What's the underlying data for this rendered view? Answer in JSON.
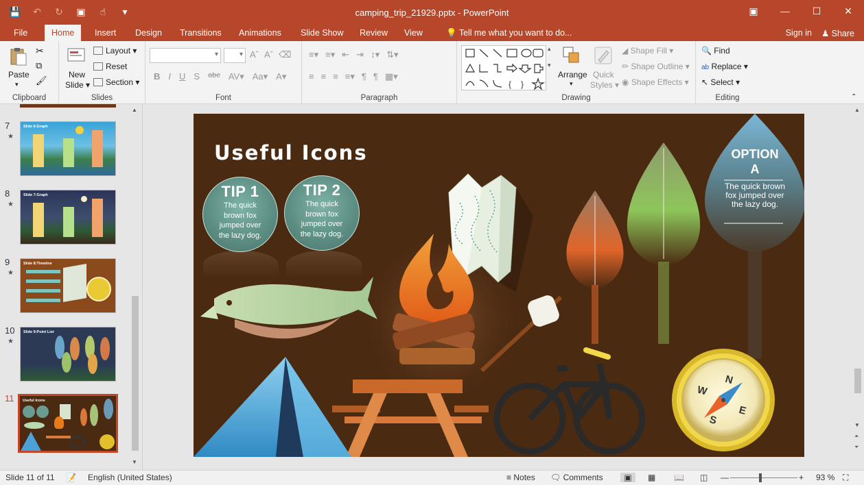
{
  "app": {
    "doc_title": "camping_trip_21929.pptx - PowerPoint",
    "accent": "#b7472a"
  },
  "tabs": [
    {
      "label": "File"
    },
    {
      "label": "Home"
    },
    {
      "label": "Insert"
    },
    {
      "label": "Design"
    },
    {
      "label": "Transitions"
    },
    {
      "label": "Animations"
    },
    {
      "label": "Slide Show"
    },
    {
      "label": "Review"
    },
    {
      "label": "View"
    }
  ],
  "tell_me": "Tell me what you want to do...",
  "sign_in": "Sign in",
  "share": "Share",
  "ribbon": {
    "clipboard": {
      "paste": "Paste",
      "label": "Clipboard"
    },
    "slides": {
      "new_slide_1": "New",
      "new_slide_2": "Slide",
      "layout": "Layout",
      "reset": "Reset",
      "section": "Section",
      "label": "Slides"
    },
    "font": {
      "label": "Font"
    },
    "paragraph": {
      "label": "Paragraph"
    },
    "drawing": {
      "arrange": "Arrange",
      "quick_styles_1": "Quick",
      "quick_styles_2": "Styles",
      "shape_fill": "Shape Fill",
      "shape_outline": "Shape Outline",
      "shape_effects": "Shape Effects",
      "label": "Drawing"
    },
    "editing": {
      "find": "Find",
      "replace": "Replace",
      "select": "Select",
      "label": "Editing"
    }
  },
  "thumbnails": [
    {
      "num": "7",
      "title": "Slide 6:Graph"
    },
    {
      "num": "8",
      "title": "Slide 7:Graph"
    },
    {
      "num": "9",
      "title": "Slide 8:Timeline"
    },
    {
      "num": "10",
      "title": "Slide 9:Point List"
    },
    {
      "num": "11",
      "title": "Useful Icons"
    }
  ],
  "slide": {
    "title": "Useful Icons",
    "tip1": {
      "head": "TIP 1",
      "body": "The quick brown fox jumped over the lazy dog."
    },
    "tip2": {
      "head": "TIP 2",
      "body": "The quick brown fox jumped over the lazy dog."
    },
    "option": {
      "head_1": "OPTION",
      "head_2": "A",
      "body": "The quick brown fox jumped over the lazy dog."
    },
    "compass": {
      "n": "N",
      "s": "S",
      "e": "E",
      "w": "W"
    }
  },
  "status": {
    "slide_of": "Slide 11 of 11",
    "language": "English (United States)",
    "notes": "Notes",
    "comments": "Comments",
    "zoom": "93 %"
  }
}
